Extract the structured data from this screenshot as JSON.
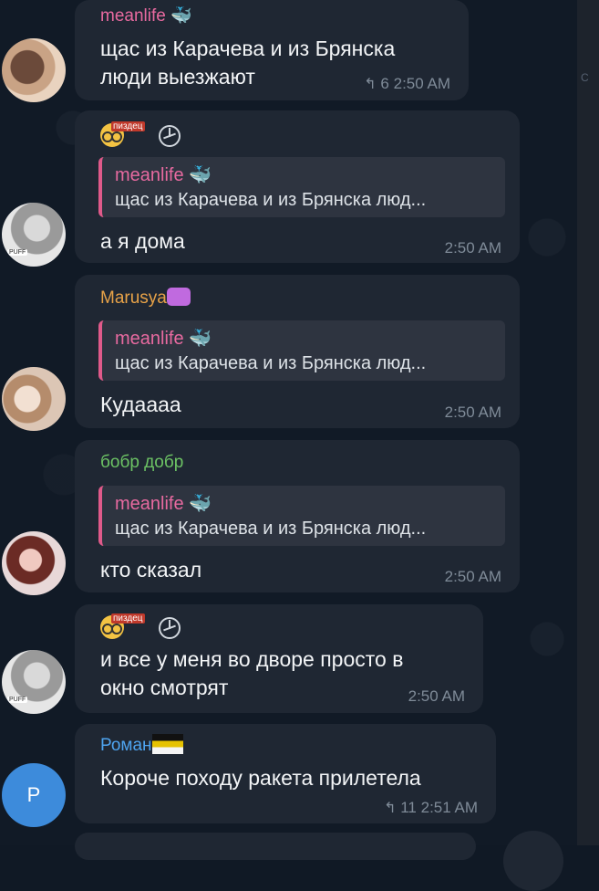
{
  "messages": [
    {
      "sender": "meanlife",
      "text_lines": [
        "щас из Карачева и из Брянска",
        "люди выезжают"
      ],
      "replies": "6",
      "time": "2:50 AM"
    },
    {
      "sender_tag": "пиздец",
      "reply": {
        "name": "meanlife",
        "text": "щас из Карачева и из Брянска люд..."
      },
      "text_lines": [
        "а я дома"
      ],
      "time": "2:50 AM"
    },
    {
      "sender": "Marusya",
      "reply": {
        "name": "meanlife",
        "text": "щас из Карачева и из Брянска люд..."
      },
      "text_lines": [
        "Кудаааа"
      ],
      "time": "2:50 AM"
    },
    {
      "sender": "бобр добр",
      "reply": {
        "name": "meanlife",
        "text": "щас из Карачева и из Брянска люд..."
      },
      "text_lines": [
        "кто сказал"
      ],
      "time": "2:50 AM"
    },
    {
      "sender_tag": "пиздец",
      "text_lines": [
        "и все у меня во дворе просто в",
        "окно смотрят"
      ],
      "time": "2:50 AM"
    },
    {
      "sender": "Роман",
      "avatar_letter": "Р",
      "text_lines": [
        "Короче походу ракета прилетела"
      ],
      "replies": "11",
      "time": "2:51 AM"
    }
  ],
  "colors": {
    "meanlife": "#e86aa0",
    "marusya": "#e7a248",
    "bobr": "#6cc264",
    "roman": "#4ea4f0"
  },
  "icons": [
    "nerd-face-icon",
    "mercedes-logo-icon",
    "whale-icon",
    "heart-icon",
    "flag-icon",
    "reply-arrow-icon"
  ]
}
